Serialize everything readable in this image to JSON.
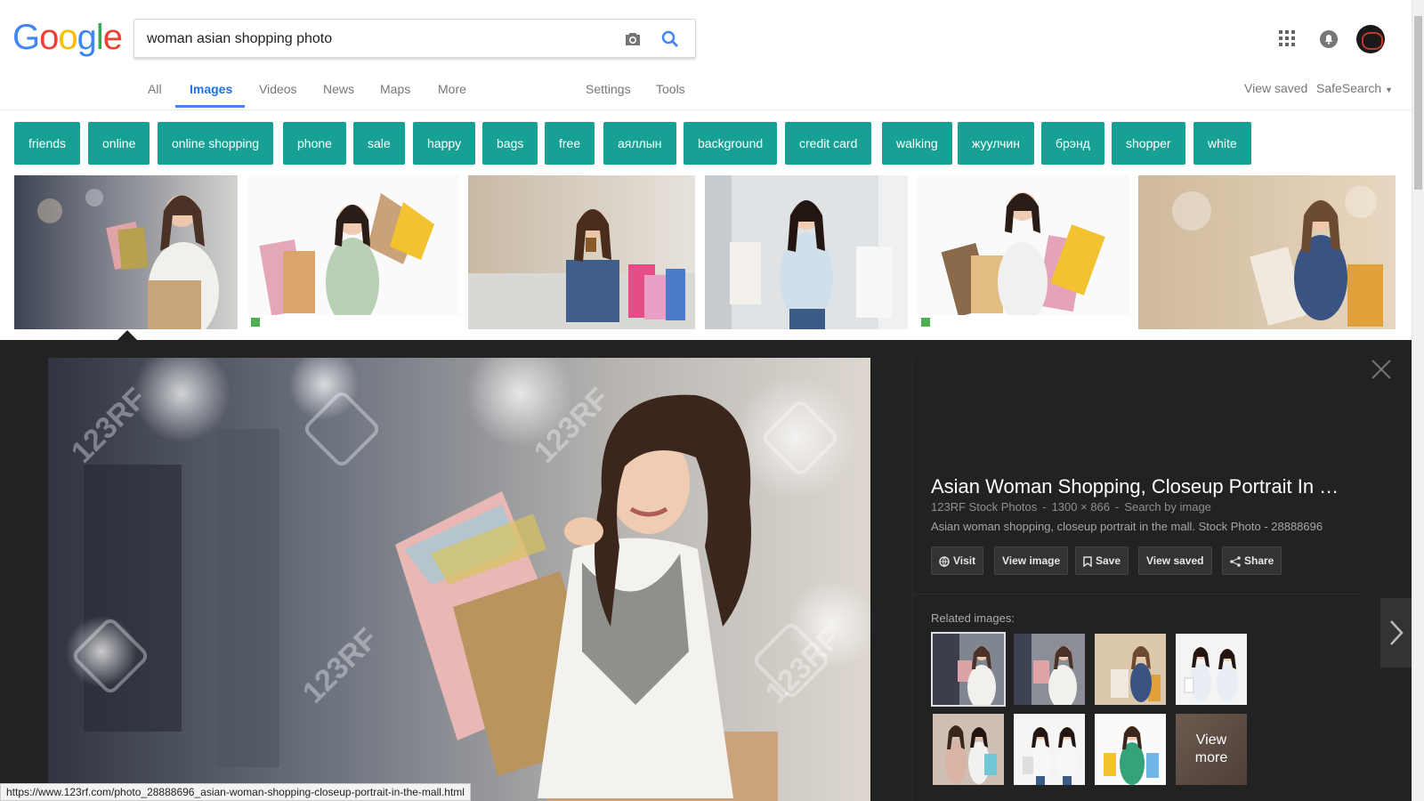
{
  "header": {
    "logo": [
      "G",
      "o",
      "o",
      "g",
      "l",
      "e"
    ],
    "logo_colors": [
      "#4285f4",
      "#ea4335",
      "#fbbc05",
      "#4285f4",
      "#34a853",
      "#ea4335"
    ],
    "search_value": "woman asian shopping photo"
  },
  "tabs": [
    "All",
    "Images",
    "Videos",
    "News",
    "Maps",
    "More",
    "Settings",
    "Tools"
  ],
  "active_tab": "Images",
  "right_links": {
    "view_saved": "View saved",
    "safesearch": "SafeSearch"
  },
  "chips": [
    "friends",
    "online",
    "online shopping",
    "phone",
    "sale",
    "happy",
    "bags",
    "free",
    "аяллын",
    "background",
    "credit card",
    "walking",
    "жуулчин",
    "брэнд",
    "shopper",
    "white"
  ],
  "results": [
    {
      "alt": "woman with shopping bags in mall"
    },
    {
      "alt": "excited woman holding bags"
    },
    {
      "alt": "woman sitting with coffee and bags"
    },
    {
      "alt": "woman holding white bags"
    },
    {
      "alt": "woman with many shopping bags"
    },
    {
      "alt": "woman cheering with bags"
    }
  ],
  "preview": {
    "title": "Asian Woman Shopping, Closeup Portrait In …",
    "source": "123RF Stock Photos",
    "dimensions": "1300 × 866",
    "search_by_image": "Search by image",
    "description": "Asian woman shopping, closeup portrait in the mall. Stock Photo - 28888696",
    "actions": [
      "Visit",
      "View image",
      "Save",
      "View saved",
      "Share"
    ],
    "related_label": "Related images:",
    "view_more": [
      "View",
      "more"
    ],
    "watermark": "123RF"
  },
  "status_url": "https://www.123rf.com/photo_28888696_asian-woman-shopping-closeup-portrait-in-the-mall.html",
  "colors": {
    "chip_bg": "#17a194",
    "accent": "#1a73e8",
    "panel_bg": "#222222"
  }
}
